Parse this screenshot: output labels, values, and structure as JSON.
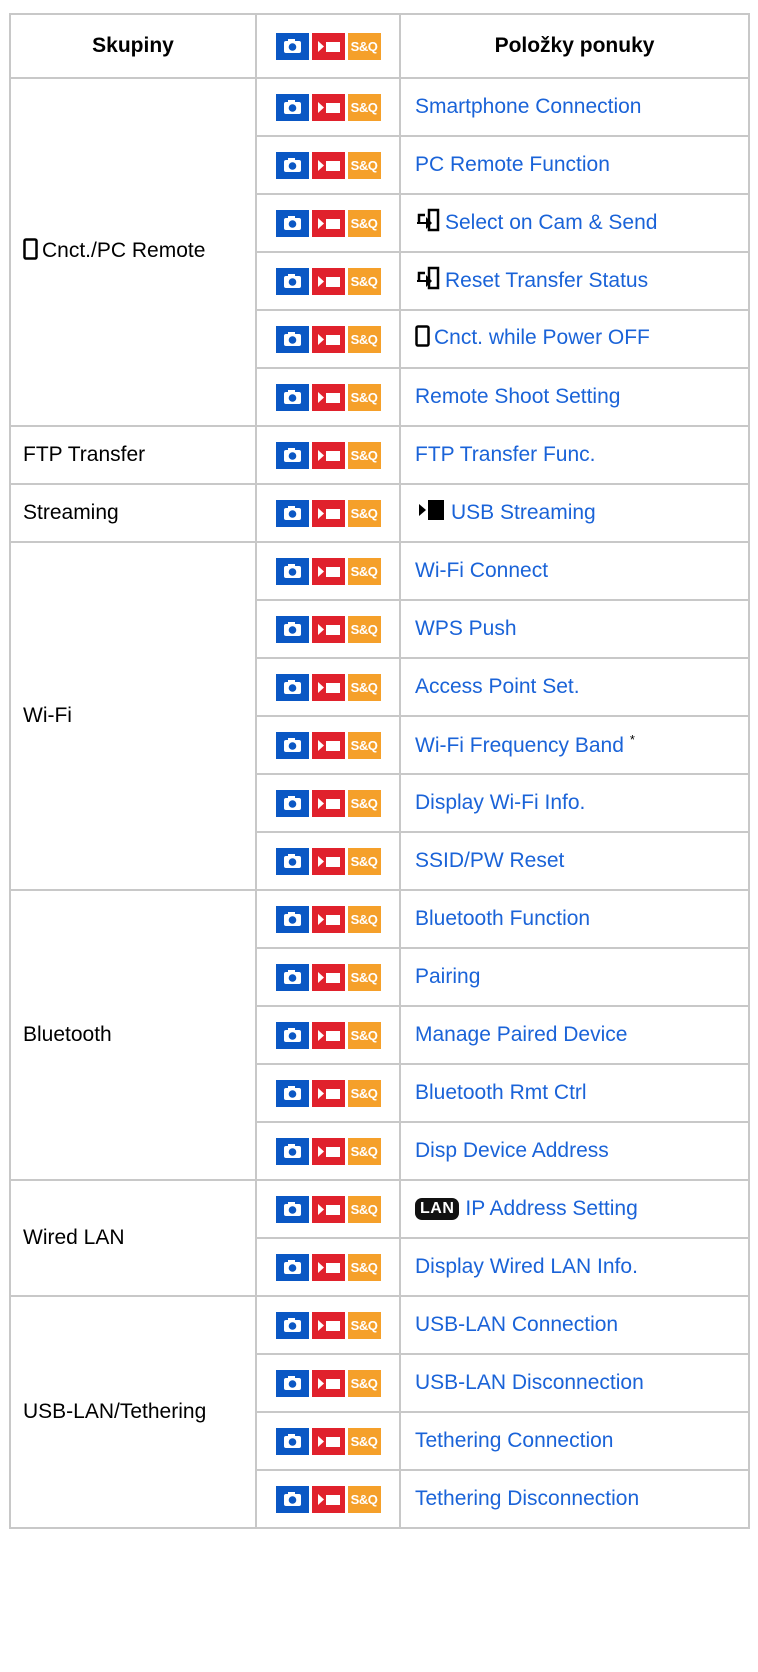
{
  "headers": {
    "groups": "Skupiny",
    "mode_sq": "S&Q",
    "items": "Položky ponuky"
  },
  "mode_sq_label": "S&Q",
  "sections": [
    {
      "group": "Cnct./PC Remote",
      "group_icon": "smartphone-icon",
      "items": [
        {
          "label": "Smartphone Connection"
        },
        {
          "label": "PC Remote Function"
        },
        {
          "label": "Select on Cam & Send",
          "icon": "transfer-icon"
        },
        {
          "label": "Reset Transfer Status",
          "icon": "transfer-icon"
        },
        {
          "label": "Cnct. while Power OFF",
          "icon": "smartphone-icon"
        },
        {
          "label": "Remote Shoot Setting"
        }
      ]
    },
    {
      "group": "FTP Transfer",
      "items": [
        {
          "label": "FTP Transfer Func."
        }
      ]
    },
    {
      "group": "Streaming",
      "items": [
        {
          "label": "USB Streaming",
          "icon": "streaming-icon"
        }
      ]
    },
    {
      "group": "Wi-Fi",
      "items": [
        {
          "label": "Wi-Fi Connect"
        },
        {
          "label": "WPS Push"
        },
        {
          "label": "Access Point Set."
        },
        {
          "label": "Wi-Fi Frequency Band",
          "note": "*"
        },
        {
          "label": "Display Wi-Fi Info."
        },
        {
          "label": "SSID/PW Reset"
        }
      ]
    },
    {
      "group": "Bluetooth",
      "items": [
        {
          "label": "Bluetooth Function"
        },
        {
          "label": "Pairing"
        },
        {
          "label": "Manage Paired Device"
        },
        {
          "label": "Bluetooth Rmt Ctrl"
        },
        {
          "label": "Disp Device Address"
        }
      ]
    },
    {
      "group": "Wired LAN",
      "items": [
        {
          "label": "IP Address Setting",
          "badge": "LAN"
        },
        {
          "label": "Display Wired LAN Info."
        }
      ]
    },
    {
      "group": "USB-LAN/Tethering",
      "items": [
        {
          "label": "USB-LAN Connection"
        },
        {
          "label": "USB-LAN Disconnection"
        },
        {
          "label": "Tethering Connection"
        },
        {
          "label": "Tethering Disconnection"
        }
      ]
    }
  ],
  "colors": {
    "photo_mode": "#0a57c4",
    "movie_mode": "#e0212c",
    "sq_mode": "#f5a02a",
    "link": "#1a63d8",
    "border": "#c8c8c8"
  }
}
